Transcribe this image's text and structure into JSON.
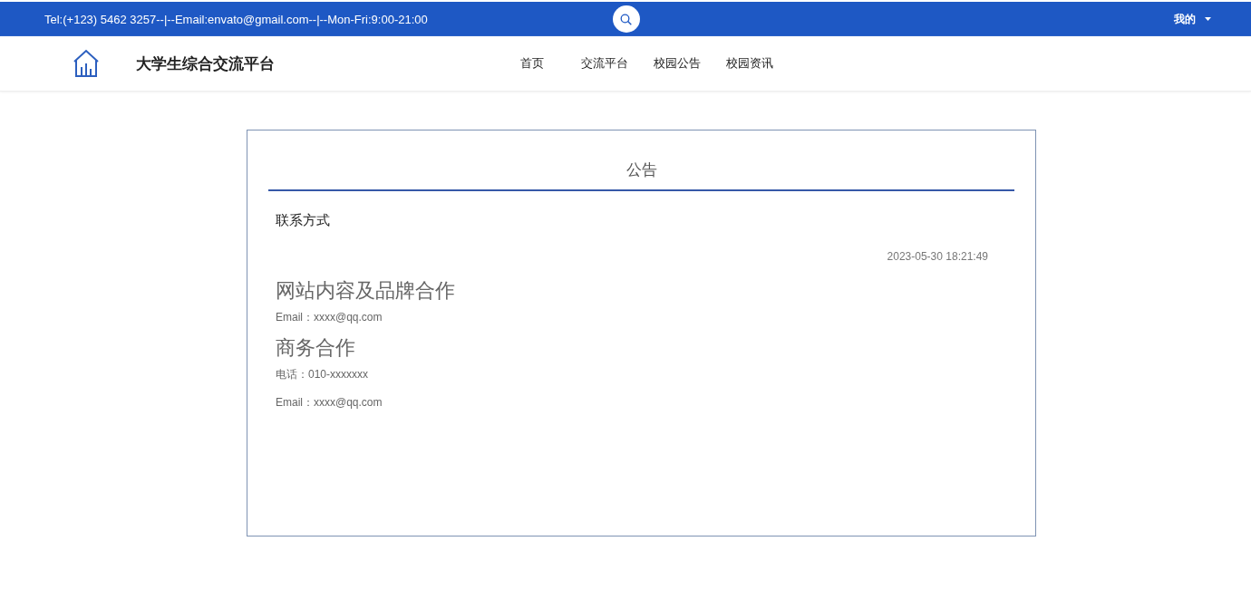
{
  "top_bar": {
    "contact": "Tel:(+123) 5462 3257--|--Email:envato@gmail.com--|--Mon-Fri:9:00-21:00",
    "user_menu": "我的"
  },
  "header": {
    "site_title": "大学生综合交流平台",
    "nav": [
      {
        "label": "首页",
        "selected": false
      },
      {
        "label": "交流平台",
        "selected": false
      },
      {
        "label": "校园公告",
        "selected": false
      },
      {
        "label": "校园资讯",
        "selected": false
      }
    ]
  },
  "notice": {
    "section_title": "公告",
    "title": "联系方式",
    "time": "2023-05-30 18:21:49",
    "content": [
      {
        "kind": "heading",
        "text": "网站内容及品牌合作"
      },
      {
        "kind": "line",
        "text": "Email：xxxx@qq.com"
      },
      {
        "kind": "heading",
        "text": "商务合作"
      },
      {
        "kind": "line",
        "text": "电话：010-xxxxxxx"
      },
      {
        "kind": "paragraph",
        "text": "Email：xxxx@qq.com"
      }
    ]
  }
}
